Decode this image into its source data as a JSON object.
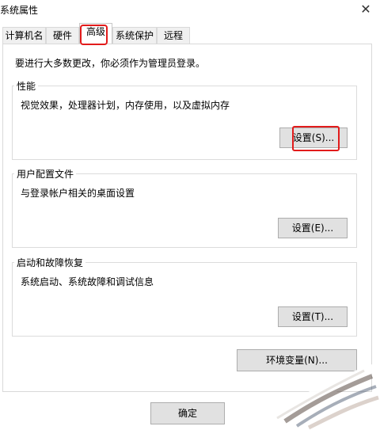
{
  "window": {
    "title": "系统属性",
    "close_symbol": "✕"
  },
  "tabs": [
    {
      "label": "计算机名"
    },
    {
      "label": "硬件"
    },
    {
      "label": "高级"
    },
    {
      "label": "系统保护"
    },
    {
      "label": "远程"
    }
  ],
  "active_tab": "高级",
  "intro_text": "要进行大多数更改，你必须作为管理员登录。",
  "groups": {
    "performance": {
      "title": "性能",
      "description": "视觉效果，处理器计划，内存使用，以及虚拟内存",
      "button_label": "设置(S)..."
    },
    "user_profiles": {
      "title": "用户配置文件",
      "description": "与登录帐户相关的桌面设置",
      "button_label": "设置(E)..."
    },
    "startup_recovery": {
      "title": "启动和故障恢复",
      "description": "系统启动、系统故障和调试信息",
      "button_label": "设置(T)..."
    }
  },
  "env_button_label": "环境变量(N)...",
  "ok_button_label": "确定",
  "colors": {
    "highlight": "#e21b1b",
    "button_bg": "#e1e1e1",
    "border": "#dcdcdc"
  }
}
